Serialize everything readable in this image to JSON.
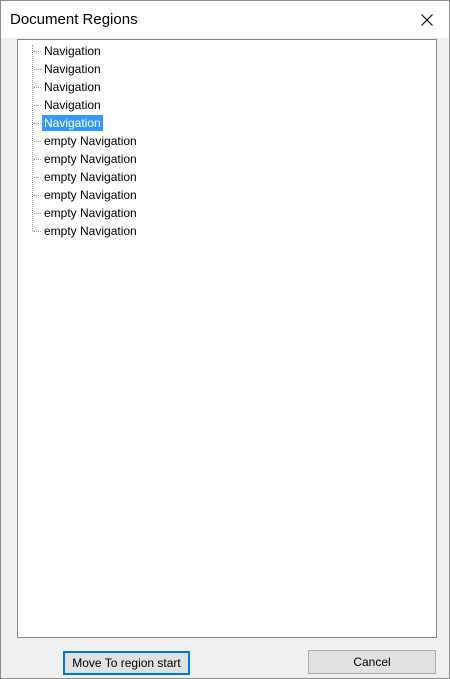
{
  "window": {
    "title": "Document Regions",
    "close_icon": "close-icon"
  },
  "tree": {
    "items": [
      {
        "label": "Navigation",
        "selected": false
      },
      {
        "label": "Navigation",
        "selected": false
      },
      {
        "label": "Navigation",
        "selected": false
      },
      {
        "label": "Navigation",
        "selected": false
      },
      {
        "label": "Navigation",
        "selected": true
      },
      {
        "label": "empty Navigation",
        "selected": false
      },
      {
        "label": "empty Navigation",
        "selected": false
      },
      {
        "label": "empty Navigation",
        "selected": false
      },
      {
        "label": "empty Navigation",
        "selected": false
      },
      {
        "label": "empty Navigation",
        "selected": false
      },
      {
        "label": "empty Navigation",
        "selected": false
      }
    ],
    "selection_color": "#3399ff"
  },
  "buttons": {
    "move_label": "Move To region start",
    "cancel_label": "Cancel"
  },
  "colors": {
    "focus_border": "#0078d7",
    "button_face": "#e1e1e1",
    "dialog_background": "#f0f0f0"
  }
}
